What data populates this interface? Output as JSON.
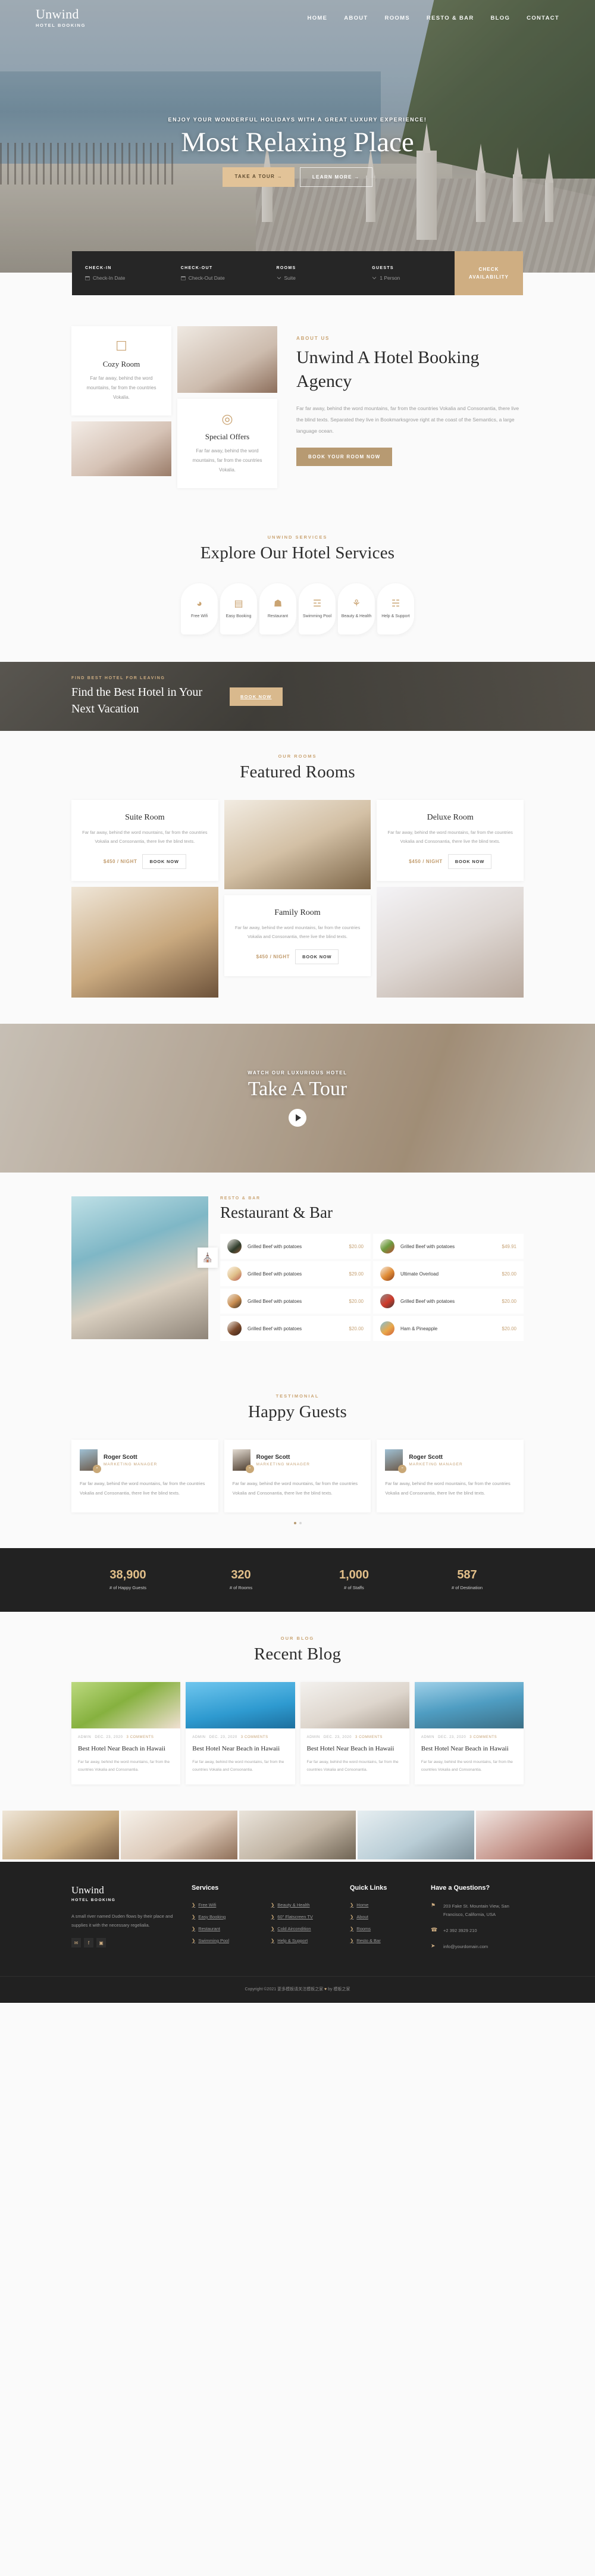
{
  "brand": {
    "name": "Unwind",
    "tagline": "HOTEL BOOKING"
  },
  "nav": {
    "items": [
      "HOME",
      "ABOUT",
      "ROOMS",
      "RESTO & BAR",
      "BLOG",
      "CONTACT"
    ]
  },
  "hero": {
    "subtitle": "ENJOY YOUR WONDERFUL HOLIDAYS WITH A GREAT LUXURY EXPERIENCE!",
    "title": "Most Relaxing Place",
    "primary_button": "TAKE A TOUR  →",
    "secondary_button": "LEARN MORE →"
  },
  "booking": {
    "fields": [
      {
        "label": "CHECK-IN",
        "value": "Check-In Date",
        "icon": "calendar-icon"
      },
      {
        "label": "CHECK-OUT",
        "value": "Check-Out Date",
        "icon": "calendar-icon"
      },
      {
        "label": "ROOMS",
        "value": "Suite",
        "icon": "chevron-down-icon"
      },
      {
        "label": "GUESTS",
        "value": "1 Person",
        "icon": "chevron-down-icon"
      }
    ],
    "submit_line1": "CHECK",
    "submit_line2": "AVAILABILITY"
  },
  "about": {
    "eyebrow": "ABOUT US",
    "title": "Unwind A Hotel Booking Agency",
    "paragraph": "Far far away, behind the word mountains, far from the countries Vokalia and Consonantia, there live the blind texts. Separated they live in Bookmarksgrove right at the coast of the Semantics, a large language ocean.",
    "button": "BOOK YOUR ROOM NOW",
    "cards": [
      {
        "icon": "bed-icon",
        "title": "Cozy Room",
        "text": "Far far away, behind the word mountains, far from the countries Vokalia."
      },
      {
        "icon": "badge-icon",
        "title": "Special Offers",
        "text": "Far far away, behind the word mountains, far from the countries Vokalia."
      }
    ]
  },
  "services": {
    "eyebrow": "UNWIND SERVICES",
    "title": "Explore Our Hotel Services",
    "items": [
      {
        "label": "Free Wifi",
        "icon": "wifi-icon",
        "glyph": "☰"
      },
      {
        "label": "Easy Booking",
        "icon": "booking-screen-icon",
        "glyph": "▤"
      },
      {
        "label": "Restaurant",
        "icon": "chef-icon",
        "glyph": "☗"
      },
      {
        "label": "Swimming Pool",
        "icon": "pool-icon",
        "glyph": "☲"
      },
      {
        "label": "Beauty & Health",
        "icon": "beauty-icon",
        "glyph": "⚘"
      },
      {
        "label": "Help & Support",
        "icon": "reception-icon",
        "glyph": "☍"
      }
    ]
  },
  "cta": {
    "eyebrow": "FIND BEST HOTEL FOR LEAVING",
    "title_line1": "Find the Best Hotel in Your",
    "title_line2": "Next Vacation",
    "button": "BOOK NOW"
  },
  "rooms": {
    "eyebrow": "OUR ROOMS",
    "title": "Featured Rooms",
    "items": [
      {
        "name": "Suite Room",
        "desc": "Far far away, behind the word mountains, far from the countries Vokalia and Consonantia, there live the blind texts.",
        "price": "$450 / NIGHT",
        "button": "BOOK NOW"
      },
      {
        "name": "Family Room",
        "desc": "Far far away, behind the word mountains, far from the countries Vokalia and Consonantia, there live the blind texts.",
        "price": "$450 / NIGHT",
        "button": "BOOK NOW"
      },
      {
        "name": "Deluxe Room",
        "desc": "Far far away, behind the word mountains, far from the countries Vokalia and Consonantia, there live the blind texts.",
        "price": "$450 / NIGHT",
        "button": "BOOK NOW"
      }
    ]
  },
  "tour": {
    "subtitle": "WATCH OUR LUXURIOUS HOTEL",
    "title": "Take A Tour",
    "play_icon": "play-icon"
  },
  "resto": {
    "eyebrow": "RESTO & BAR",
    "title": "Restaurant & Bar",
    "menu": [
      {
        "name": "Grilled Beef with potatoes",
        "price": "$20.00"
      },
      {
        "name": "Grilled Beef with potatoes",
        "price": "$49.91"
      },
      {
        "name": "Grilled Beef with potatoes",
        "price": "$29.00"
      },
      {
        "name": "Ultimate Overload",
        "price": "$20.00"
      },
      {
        "name": "Grilled Beef with potatoes",
        "price": "$20.00"
      },
      {
        "name": "Grilled Beef with potatoes",
        "price": "$20.00"
      },
      {
        "name": "Grilled Beef with potatoes",
        "price": "$20.00"
      },
      {
        "name": "Ham & Pineapple",
        "price": "$20.00"
      }
    ]
  },
  "testimonial": {
    "eyebrow": "TESTIMONIAL",
    "title": "Happy Guests",
    "items": [
      {
        "name": "Roger Scott",
        "role": "MARKETING MANAGER",
        "text": "Far far away, behind the word mountains, far from the countries Vokalia and Consonantia, there live the blind texts."
      },
      {
        "name": "Roger Scott",
        "role": "MARKETING MANAGER",
        "text": "Far far away, behind the word mountains, far from the countries Vokalia and Consonantia, there live the blind texts."
      },
      {
        "name": "Roger Scott",
        "role": "MARKETING MANAGER",
        "text": "Far far away, behind the word mountains, far from the countries Vokalia and Consonantia, there live the blind texts."
      }
    ]
  },
  "counters": [
    {
      "number": "38,900",
      "label": "# of Happy Guests"
    },
    {
      "number": "320",
      "label": "# of Rooms"
    },
    {
      "number": "1,000",
      "label": "# of Staffs"
    },
    {
      "number": "587",
      "label": "# of Destination"
    }
  ],
  "blog": {
    "eyebrow": "OUR BLOG",
    "title": "Recent Blog",
    "posts": [
      {
        "author": "ADMIN",
        "date": "DEC. 23, 2020",
        "comments": "3 COMMENTS",
        "title": "Best Hotel Near Beach in Hawaii",
        "excerpt": "Far far away, behind the word mountains, far from the countries Vokalia and Consonantia."
      },
      {
        "author": "ADMIN",
        "date": "DEC. 23, 2020",
        "comments": "3 COMMENTS",
        "title": "Best Hotel Near Beach in Hawaii",
        "excerpt": "Far far away, behind the word mountains, far from the countries Vokalia and Consonantia."
      },
      {
        "author": "ADMIN",
        "date": "DEC. 23, 2020",
        "comments": "3 COMMENTS",
        "title": "Best Hotel Near Beach in Hawaii",
        "excerpt": "Far far away, behind the word mountains, far from the countries Vokalia and Consonantia."
      },
      {
        "author": "ADMIN",
        "date": "DEC. 23, 2020",
        "comments": "3 COMMENTS",
        "title": "Best Hotel Near Beach in Hawaii",
        "excerpt": "Far far away, behind the word mountains, far from the countries Vokalia and Consonantia."
      }
    ]
  },
  "footer": {
    "brand_name": "Unwind",
    "brand_tagline": "HOTEL BOOKING",
    "description": "A small river named Duden flows by their place and supplies it with the necessary regelialia.",
    "social": [
      {
        "icon": "twitter-icon",
        "glyph": "✉"
      },
      {
        "icon": "facebook-icon",
        "glyph": "f"
      },
      {
        "icon": "instagram-icon",
        "glyph": "▣"
      }
    ],
    "services_heading": "Services",
    "services_col1": [
      "Free Wifi",
      "Easy Booking",
      "Restaurant",
      "Swimming Pool"
    ],
    "services_col2": [
      "Beauty & Health",
      "60\" Flatscreen TV",
      "Cold Aircondition",
      "Help & Support"
    ],
    "quicklinks_heading": "Quick Links",
    "quicklinks": [
      "Home",
      "About",
      "Rooms",
      "Resto & Bar"
    ],
    "contact_heading": "Have a Questions?",
    "contact": [
      {
        "icon": "map-marker-icon",
        "glyph": "⚑",
        "text": "203 Fake St. Mountain View, San Francisco, California, USA"
      },
      {
        "icon": "phone-icon",
        "glyph": "☎",
        "text": "+2 392 3929 210"
      },
      {
        "icon": "paper-plane-icon",
        "glyph": "➤",
        "text": "info@yourdomain.com"
      }
    ],
    "copyright_pre": "Copyright ©2021 更多模板请关注模板之家",
    "copyright_heart": "♥",
    "copyright_post": "by 模板之家"
  },
  "colors": {
    "accent": "#caa473",
    "gold": "#e2c398",
    "dark": "#222222",
    "page_bg": "#fafafa"
  }
}
